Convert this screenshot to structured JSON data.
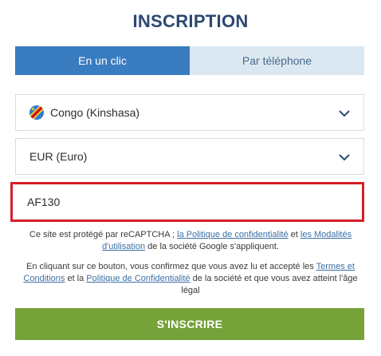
{
  "title": "INSCRIPTION",
  "tabs": [
    {
      "label": "En un clic",
      "active": true
    },
    {
      "label": "Par téléphone",
      "active": false
    }
  ],
  "country": {
    "value": "Congo (Kinshasa)",
    "flag_icon": "drc-flag-icon"
  },
  "currency": {
    "value": "EUR (Euro)"
  },
  "promo": {
    "value": "AF130"
  },
  "recaptcha": {
    "text1": "Ce site est protégé par reCAPTCHA ; ",
    "link1": "la Politique de confidentialité",
    "text2": " et ",
    "link2": "les Modalités d'utilisation",
    "text3": " de la société Google s'appliquent."
  },
  "terms": {
    "text1": "En cliquant sur ce bouton, vous confirmez que vous avez lu et accepté les ",
    "link1": "Termes et Conditions",
    "text2": " et la ",
    "link2": "Politique de Confidentialité",
    "text3": " de la société et que vous avez atteint l'âge légal"
  },
  "submit_label": "S'INSCRIRE",
  "colors": {
    "title": "#2b4870",
    "tab_active_bg": "#3a7cc0",
    "tab_inactive_bg": "#dce8f1",
    "promo_border": "#d42027",
    "submit_bg": "#76a23a",
    "link": "#3a6fa5"
  }
}
